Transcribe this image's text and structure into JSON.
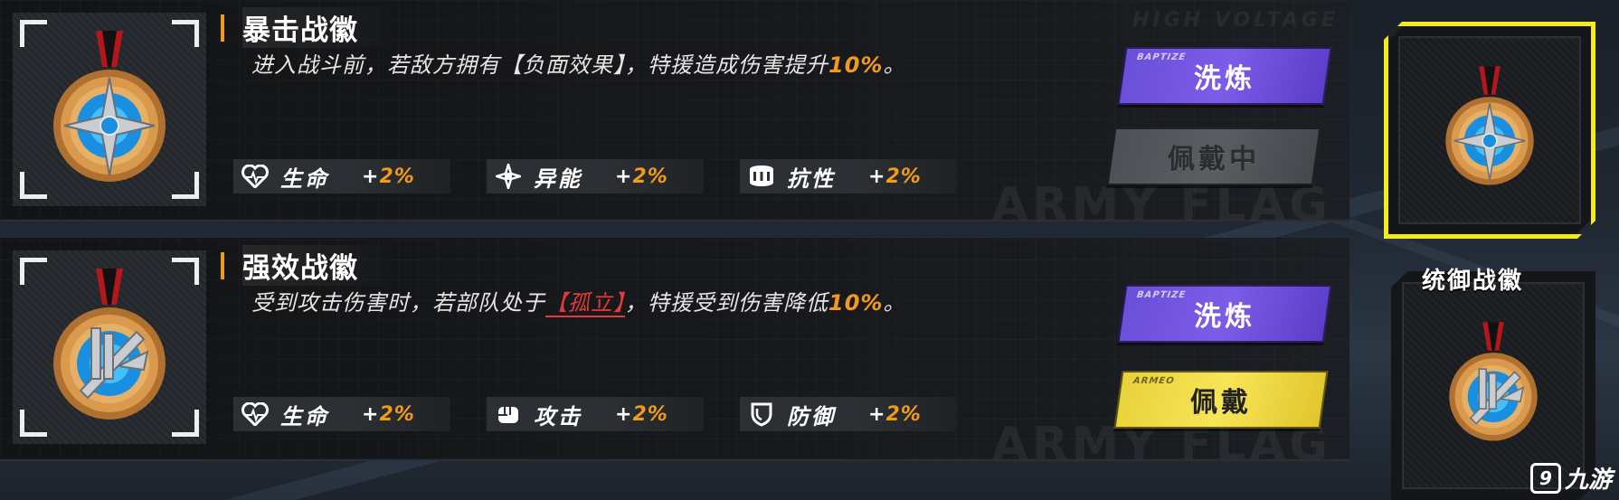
{
  "background_text": {
    "high_voltage": "HIGH VOLTAGE",
    "army_flag": "ARMY FLAG"
  },
  "medals": [
    {
      "title": "暴击战徽",
      "desc_before": "进入战斗前，若敌方拥有【负面效果】，特援造成伤害提升",
      "desc_highlight": "10%",
      "desc_after": "。",
      "stats": [
        {
          "icon": "heart-pulse-icon",
          "name": "生命",
          "plus": "+",
          "value": "2%"
        },
        {
          "icon": "energy-star-icon",
          "name": "异能",
          "plus": "+",
          "value": "2%"
        },
        {
          "icon": "resist-drum-icon",
          "name": "抗性",
          "plus": "+",
          "value": "2%"
        }
      ],
      "buttons": {
        "refine": {
          "label": "洗炼",
          "sub": "BAPTIZE"
        },
        "equip": {
          "label": "佩戴中",
          "state": "equipped"
        }
      }
    },
    {
      "title": "强效战徽",
      "desc_before": "受到攻击伤害时，若部队处于",
      "desc_tag": "【孤立】",
      "desc_middle": "，特援受到伤害降低",
      "desc_highlight": "10%",
      "desc_after": "。",
      "stats": [
        {
          "icon": "heart-pulse-icon",
          "name": "生命",
          "plus": "+",
          "value": "2%"
        },
        {
          "icon": "fist-icon",
          "name": "攻击",
          "plus": "+",
          "value": "2%"
        },
        {
          "icon": "shield-icon",
          "name": "防御",
          "plus": "+",
          "value": "2%"
        }
      ],
      "buttons": {
        "refine": {
          "label": "洗炼",
          "sub": "BAPTIZE"
        },
        "equip": {
          "label": "佩戴",
          "sub": "ARMEO",
          "state": "available"
        }
      }
    }
  ],
  "side_panel": {
    "slot_title": "统御战徽"
  },
  "watermark": {
    "text": "九游"
  },
  "colors": {
    "accent_orange": "#f29a1a",
    "tag_red": "#e33b3b",
    "purple_button": "#7b5ce8",
    "yellow_button": "#f7e558",
    "selection_yellow": "#f4ec1a"
  }
}
